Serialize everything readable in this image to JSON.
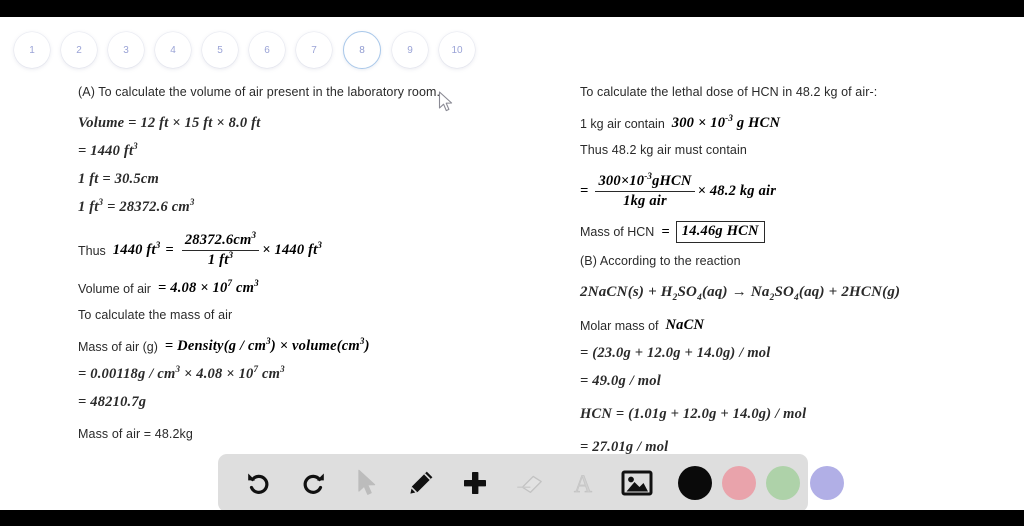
{
  "pager": {
    "pages": [
      "1",
      "2",
      "3",
      "4",
      "5",
      "6",
      "7",
      "8",
      "9",
      "10"
    ],
    "active_index": 7
  },
  "left_column": {
    "heading": "(A) To calculate the volume of air present in the laboratory room.",
    "volume_label": "Volume",
    "volume_expr": "= 12 ft × 15 ft × 8.0 ft",
    "volume_result": "= 1440 ft",
    "volume_result_exp": "3",
    "ft_to_cm": "1 ft = 30.5cm",
    "ft3_label": "1 ft",
    "ft3_exp": "3",
    "ft3_value": "= 28372.6 cm",
    "ft3_value_exp": "3",
    "thus_label": "Thus",
    "thus_lhs": "1440 ft",
    "thus_lhs_exp": "3",
    "thus_eq": "=",
    "frac_num": "28372.6cm",
    "frac_num_exp": "3",
    "frac_den": "1 ft",
    "frac_den_exp": "3",
    "thus_rhs": "× 1440  ft",
    "thus_rhs_exp": "3",
    "volair_label": "Volume of air",
    "volair_value": "= 4.08 × 10",
    "volair_exp": "7",
    "volair_unit": "cm",
    "volair_unit_exp": "3",
    "mass_heading": "To calculate the mass of air",
    "mass_label": "Mass of air (g)",
    "mass_expr_a": "= Density",
    "mass_expr_b": "(g / cm",
    "mass_expr_b_exp": "3",
    "mass_expr_c": ") × volume",
    "mass_expr_d": "(cm",
    "mass_expr_d_exp": "3",
    "mass_expr_e": ")",
    "mass_calc": "= 0.00118g / cm",
    "mass_calc_exp": "3",
    "mass_calc_b": "× 4.08 × 10",
    "mass_calc_b_exp": "7",
    "mass_calc_c": "cm",
    "mass_calc_c_exp": "3",
    "mass_result": "= 48210.7g",
    "mass_final": "Mass of air = 48.2kg"
  },
  "right_column": {
    "heading": "To calculate the lethal dose of HCN in 48.2 kg of air-:",
    "contain_label": "1 kg air contain",
    "contain_value": "300 × 10",
    "contain_exp": "-3",
    "contain_unit": "g HCN",
    "thus_line": "Thus 48.2 kg air must contain",
    "eq_sign": "=",
    "frac_num": "300×10",
    "frac_num_exp": "-3",
    "frac_num_unit": "gHCN",
    "frac_den": "1kg air",
    "frac_rhs": "× 48.2 kg air",
    "mass_hcn_label": "Mass of HCN",
    "mass_hcn_eq": "=",
    "mass_hcn_boxed": "14.46g HCN",
    "part_b": "(B) According to the reaction",
    "reaction": {
      "lhs_coeff": "2",
      "lhs_a": "NaCN",
      "lhs_a_state": "(s)",
      "plus": "+",
      "lhs_b_h": "H",
      "lhs_b_h_sub": "2",
      "lhs_b_so": "SO",
      "lhs_b_so_sub": "4",
      "lhs_b_state": "(aq)",
      "arrow": "→",
      "rhs_a_na": "Na",
      "rhs_a_na_sub": "2",
      "rhs_a_so": "SO",
      "rhs_a_so_sub": "4",
      "rhs_a_state": "(aq)",
      "plus2": "+",
      "rhs_b_coeff": "2",
      "rhs_b": "HCN",
      "rhs_b_state": "(g)"
    },
    "molar_label": "Molar mass of",
    "molar_species": "NaCN",
    "molar_calc": "= (23.0g + 12.0g + 14.0g) / mol",
    "molar_result": "= 49.0g / mol",
    "hcn_calc": "HCN = (1.01g + 12.0g + 14.0g) / mol",
    "hcn_result": "= 27.01g / mol"
  },
  "toolbar": {
    "tools": [
      {
        "name": "undo-icon",
        "label": "Undo",
        "state": "enabled"
      },
      {
        "name": "redo-icon",
        "label": "Redo",
        "state": "enabled"
      },
      {
        "name": "cursor-icon",
        "label": "Select",
        "state": "disabled"
      },
      {
        "name": "pencil-icon",
        "label": "Draw",
        "state": "enabled"
      },
      {
        "name": "plus-icon",
        "label": "Add",
        "state": "enabled"
      },
      {
        "name": "eraser-icon",
        "label": "Erase",
        "state": "disabled"
      },
      {
        "name": "text-icon",
        "label": "Text",
        "state": "disabled"
      },
      {
        "name": "image-icon",
        "label": "Image",
        "state": "enabled"
      }
    ],
    "swatches": [
      {
        "name": "color-swatch-black",
        "color": "#0a0a0a"
      },
      {
        "name": "color-swatch-pink",
        "color": "#e9a3ab"
      },
      {
        "name": "color-swatch-green",
        "color": "#aed2a9"
      },
      {
        "name": "color-swatch-purple",
        "color": "#b1afe6"
      }
    ],
    "background": "#dedede"
  },
  "colors": {
    "page_background": "#ffffff",
    "letterbox": "#000000",
    "pager_number": "#9aa3d6",
    "pager_active_ring": "#a9c8ea",
    "text": "#2a2a2a"
  }
}
